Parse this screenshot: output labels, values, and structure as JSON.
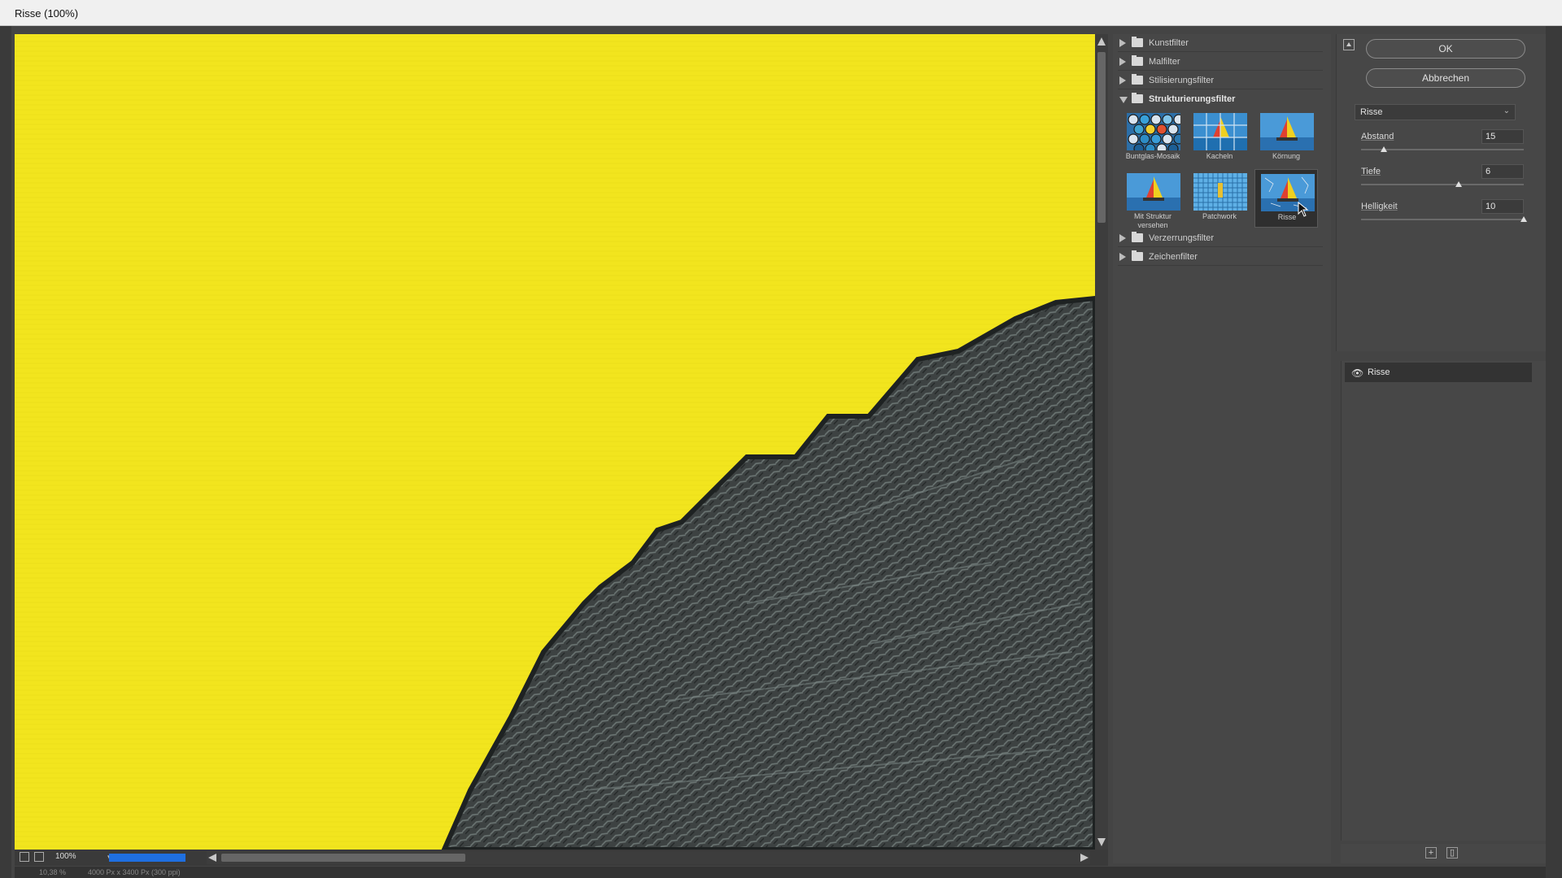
{
  "window": {
    "title": "Risse (100%)"
  },
  "preview": {
    "zoom": "100%",
    "status_left": "10,38 %",
    "status_doc": "4000 Px x 3400 Px (300 ppi)"
  },
  "gallery": {
    "categories": [
      {
        "label": "Kunstfilter",
        "open": false
      },
      {
        "label": "Malfilter",
        "open": false
      },
      {
        "label": "Stilisierungsfilter",
        "open": false
      },
      {
        "label": "Strukturierungsfilter",
        "open": true
      },
      {
        "label": "Verzerrungsfilter",
        "open": false
      },
      {
        "label": "Zeichenfilter",
        "open": false
      }
    ],
    "thumbnails": [
      {
        "label": "Buntglas-Mosaik",
        "icon": "stained-glass-thumbnail"
      },
      {
        "label": "Kacheln",
        "icon": "tiles-thumbnail"
      },
      {
        "label": "Körnung",
        "icon": "grain-thumbnail"
      },
      {
        "label": "Mit Struktur versehen",
        "icon": "texturizer-thumbnail"
      },
      {
        "label": "Patchwork",
        "icon": "patchwork-thumbnail"
      },
      {
        "label": "Risse",
        "icon": "craquelure-thumbnail",
        "selected": true
      }
    ]
  },
  "settings": {
    "ok_label": "OK",
    "cancel_label": "Abbrechen",
    "filter_selected": "Risse",
    "params": [
      {
        "label": "Abstand",
        "value": "15",
        "level": 0.14
      },
      {
        "label": "Tiefe",
        "value": "6",
        "level": 0.6
      },
      {
        "label": "Helligkeit",
        "value": "10",
        "level": 1.0
      }
    ]
  },
  "layers": {
    "items": [
      {
        "label": "Risse",
        "visible": true
      }
    ]
  },
  "colors": {
    "preview_yellow": "#f2e51e",
    "rock_dark": "#3f4444",
    "progress_blue": "#1f6fe0"
  }
}
